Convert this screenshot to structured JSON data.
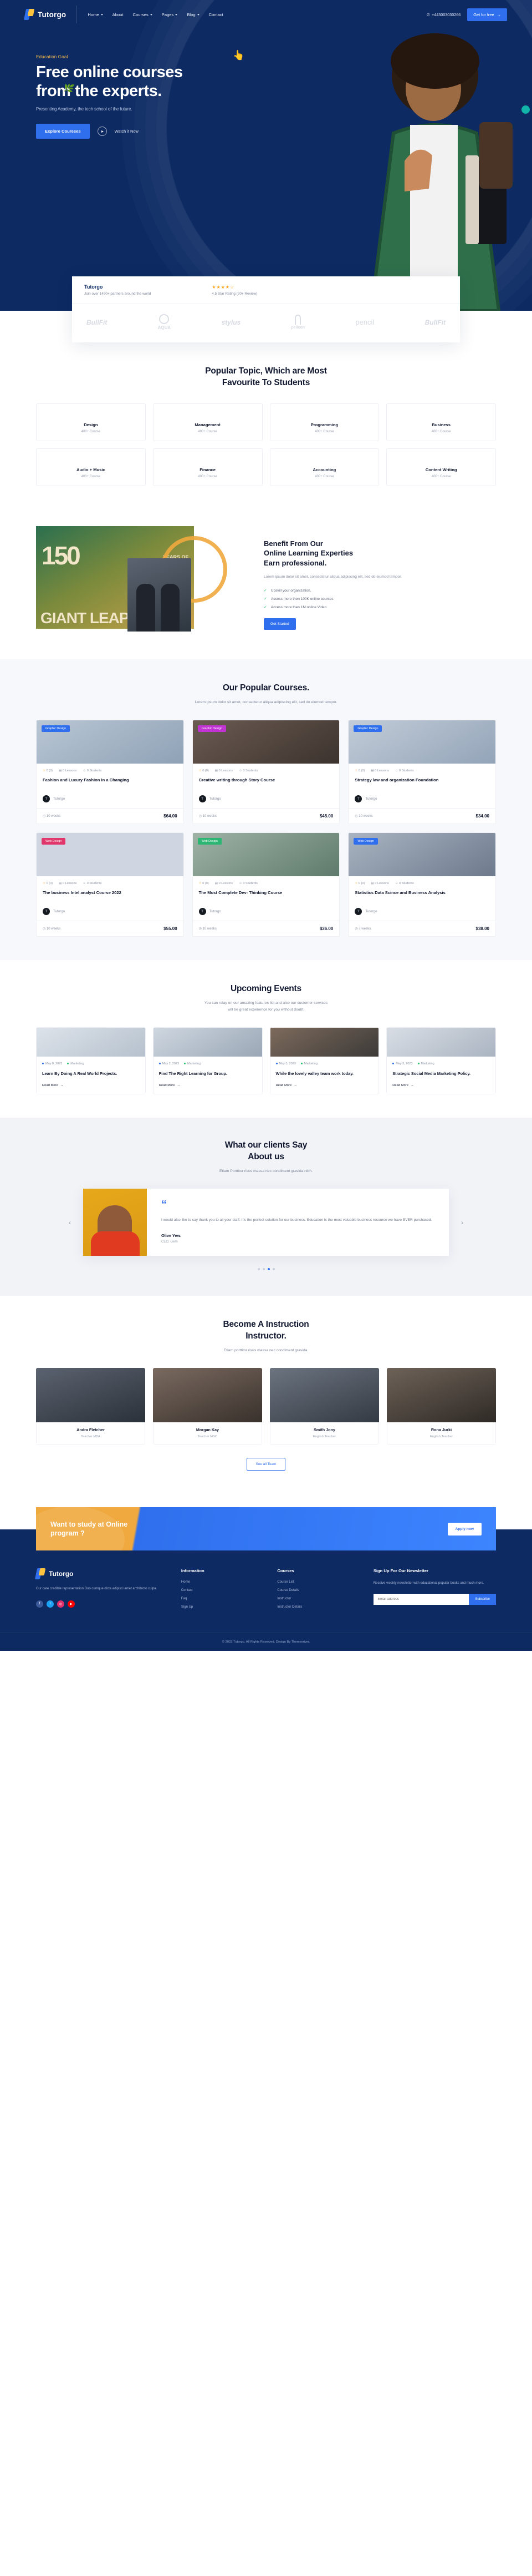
{
  "nav": {
    "brand": "Tutorgo",
    "items": [
      {
        "label": "Home",
        "caret": true
      },
      {
        "label": "About",
        "caret": false
      },
      {
        "label": "Courses",
        "caret": true
      },
      {
        "label": "Pages",
        "caret": true
      },
      {
        "label": "Blog",
        "caret": true
      },
      {
        "label": "Contact",
        "caret": false
      }
    ],
    "phone": "+443003030266",
    "cta": "Get for free"
  },
  "hero": {
    "eyebrow": "Education Goal",
    "title_line1": "Free online courses",
    "title_line2": "from the experts.",
    "subtitle": "Presenting Academy, the tech school of the future.",
    "primary_btn": "Explore Coureses",
    "secondary_btn": "Watch it Now"
  },
  "partners": {
    "name": "Tutorgo",
    "subtitle": "Join over 1490+ partners around the world",
    "stars": "★★★★☆",
    "rating": "4.5 Star Rating (20+ Review)",
    "logos": [
      "BullFit",
      "AQUA",
      "stylus",
      "pelicon",
      "pencil",
      "BullFit"
    ]
  },
  "topics": {
    "title_line1": "Popular Topic, Which are Most",
    "title_line2": "Favourite To Students",
    "items": [
      {
        "name": "Design",
        "count": "400+ Course"
      },
      {
        "name": "Management",
        "count": "400+ Course"
      },
      {
        "name": "Programming",
        "count": "400+ Course"
      },
      {
        "name": "Business",
        "count": "400+ Course"
      },
      {
        "name": "Audio + Music",
        "count": "400+ Course"
      },
      {
        "name": "Finance",
        "count": "400+ Course"
      },
      {
        "name": "Accounting",
        "count": "400+ Course"
      },
      {
        "name": "Content Writing",
        "count": "400+ Course"
      }
    ]
  },
  "benefit": {
    "image_text_big": "GIANT LEAPS",
    "image_text_num": "150",
    "image_text_years": "YEARS OF",
    "title_line1": "Benefit From Our",
    "title_line2": "Online Learning Experties",
    "title_line3": "Earn professional.",
    "paragraph": "Lorem ipsum dolor sit amet, consectetur aliqua adipiscing elit, sed do eiumod tempor.",
    "bullets": [
      "Upskill your organization.",
      "Access more then 100K online courses",
      "Access more then 1M online Video"
    ],
    "button": "Get Started"
  },
  "courses": {
    "title": "Our Popular Courses.",
    "subtitle": "Lorem ipsum dolor sit amet, consectetur aliqua adipiscing elit, sed do eiumod tempor.",
    "items": [
      {
        "tag": "Graphic Design",
        "tag_color": "#2f6fed",
        "rating": "0 (0)",
        "lessons": "0 Lessons",
        "students": "0 Students",
        "title": "Fashion and Luxury Fashion in a Changing",
        "author": "Tutorgo",
        "weeks": "10 weeks",
        "price": "$64.00"
      },
      {
        "tag": "Graphic Design",
        "tag_color": "#c233d4",
        "rating": "0 (0)",
        "lessons": "0 Lessons",
        "students": "0 Students",
        "title": "Creative writing through Story Course",
        "author": "Tutorgo",
        "weeks": "10 weeks",
        "price": "$45.00"
      },
      {
        "tag": "Graphic Design",
        "tag_color": "#2f6fed",
        "rating": "0 (0)",
        "lessons": "0 Lessons",
        "students": "0 Students",
        "title": "Strategy law and organization Foundation",
        "author": "Tutorgo",
        "weeks": "10 weeks",
        "price": "$34.00"
      },
      {
        "tag": "Web Design",
        "tag_color": "#e0366b",
        "rating": "0 (0)",
        "lessons": "0 Lessons",
        "students": "0 Students",
        "title": "The business Intel analyst Course 2022",
        "author": "Tutorgo",
        "weeks": "10 weeks",
        "price": "$55.00"
      },
      {
        "tag": "Web Design",
        "tag_color": "#2bb673",
        "rating": "0 (0)",
        "lessons": "0 Lessons",
        "students": "0 Students",
        "title": "The Most Complete Dev- Thinking Course",
        "author": "Tutorgo",
        "weeks": "10 weeks",
        "price": "$36.00"
      },
      {
        "tag": "Web Design",
        "tag_color": "#2f6fed",
        "rating": "0 (0)",
        "lessons": "0 Lessons",
        "students": "0 Students",
        "title": "Statistics Data Scince and Business Analysis",
        "author": "Tutorgo",
        "weeks": "7 weeks",
        "price": "$38.00"
      }
    ]
  },
  "events": {
    "title": "Upcoming Events",
    "subtitle_line1": "You can relay on our amazing features list and also our customer services",
    "subtitle_line2": "will be great experience for you without doubt.",
    "items": [
      {
        "date": "May 8, 2023",
        "category": "Marketing",
        "title": "Learn By Doing A Real World Projects.",
        "read": "Read More"
      },
      {
        "date": "May 2, 2023",
        "category": "Marketing",
        "title": "Find The Right Learning for Group.",
        "read": "Read More"
      },
      {
        "date": "May 3, 2023",
        "category": "Marketing",
        "title": "While the lovely valley team work today.",
        "read": "Read More"
      },
      {
        "date": "May 3, 2023",
        "category": "Marketing",
        "title": "Strategic Social Media Marketing Policy.",
        "read": "Read More"
      }
    ]
  },
  "testimonial": {
    "title_line1": "What our clients Say",
    "title_line2": "About us",
    "subtitle": "Etiam Porttitor risus massa nec condiment gravida nibh.",
    "quote_mark": "“",
    "quote": "I would also like to say thank you to all your staff. It's the perfect solution for our business. Education is the most valuable business resource we have EVER purchased.",
    "name": "Olive Yew.",
    "role": "CEO, Gerh",
    "prev": "‹",
    "next": "›"
  },
  "instructors": {
    "title_line1": "Become A Instruction",
    "title_line2": "Instructor.",
    "subtitle": "Etiam porttitor risus massa nec condiment gravida.",
    "items": [
      {
        "name": "Andra Fletcher",
        "role": "Teacher MBA"
      },
      {
        "name": "Morgan Kay",
        "role": "Teacher MSC"
      },
      {
        "name": "Smith Jony",
        "role": "English Teacher"
      },
      {
        "name": "Rona Jurki",
        "role": "English Teacher"
      }
    ],
    "button": "See all Team"
  },
  "cta_banner": {
    "title_line1": "Want to study at Online",
    "title_line2": "program ?",
    "button": "Apply now"
  },
  "footer": {
    "brand": "Tutorgo",
    "about": "Our care credible representation Duo cumque dicta adipisci amet architecto culpa.",
    "social": [
      {
        "name": "facebook-icon",
        "glyph": "f",
        "color": "#3b5998"
      },
      {
        "name": "twitter-icon",
        "glyph": "t",
        "color": "#1da1f2"
      },
      {
        "name": "instagram-icon",
        "glyph": "◎",
        "color": "#e1306c"
      },
      {
        "name": "youtube-icon",
        "glyph": "▶",
        "color": "#ff0000"
      }
    ],
    "columns": [
      {
        "heading": "Information",
        "links": [
          "Home",
          "Contact",
          "Faq",
          "Sign Up"
        ]
      },
      {
        "heading": "Courses",
        "links": [
          "Course List",
          "Course Details",
          "Instructor",
          "Instructor Details"
        ]
      }
    ],
    "newsletter": {
      "heading": "Sign Up For Our Newsletter",
      "text": "Receive weekly newsletter with educational popular books and much more.",
      "placeholder": "Email address",
      "button": "Subscribe"
    },
    "copyright": "© 2023 Tutorgo. All Rights Reserved. Design By Themexriver."
  }
}
